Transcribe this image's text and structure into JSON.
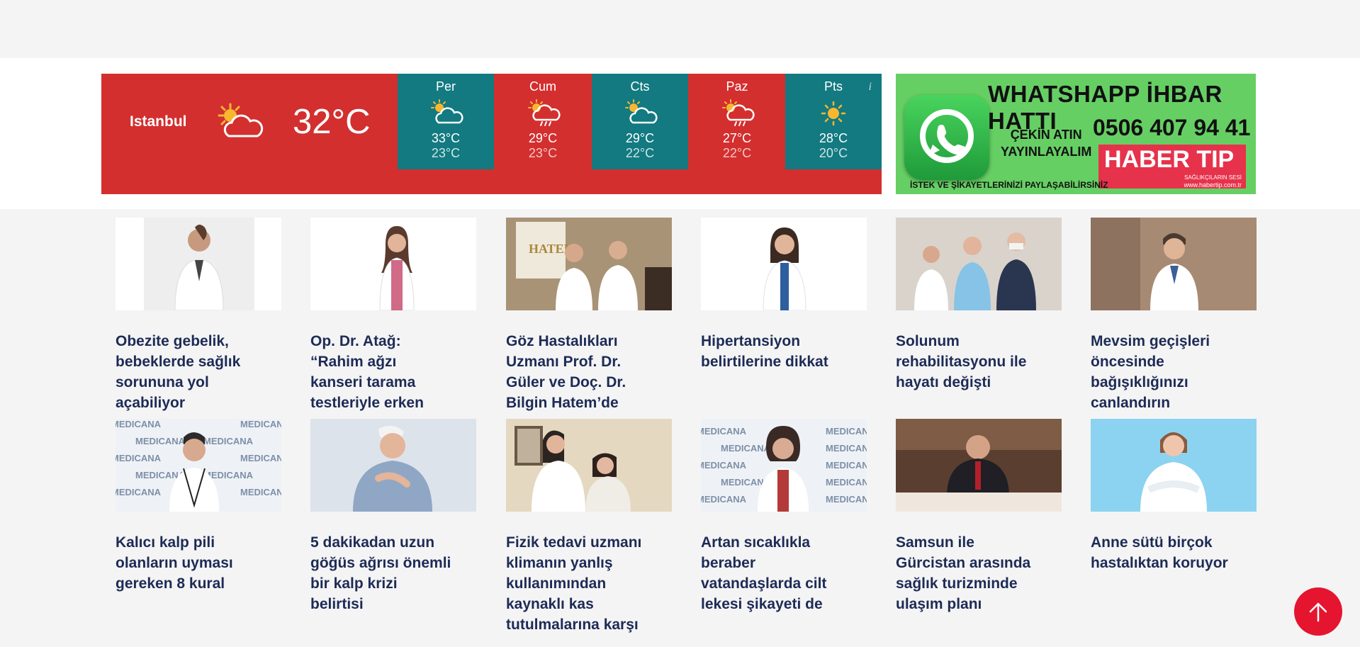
{
  "weather": {
    "city": "Istanbul",
    "current_temp": "32°C",
    "current_icon": "sun-cloud-icon",
    "info": "i",
    "days": [
      {
        "name": "Per",
        "high": "33°C",
        "low": "23°C",
        "icon": "sun-cloud-icon"
      },
      {
        "name": "Cum",
        "high": "29°C",
        "low": "23°C",
        "icon": "sun-cloud-rain-icon"
      },
      {
        "name": "Cts",
        "high": "29°C",
        "low": "22°C",
        "icon": "sun-cloud-icon"
      },
      {
        "name": "Paz",
        "high": "27°C",
        "low": "22°C",
        "icon": "sun-cloud-rain-icon"
      },
      {
        "name": "Pts",
        "high": "28°C",
        "low": "20°C",
        "icon": "sun-icon"
      }
    ]
  },
  "ad": {
    "title": "WHATSHAPP İHBAR HATTI",
    "phone": "0506 407 94 41",
    "cta_line1": "ÇEKİN ATIN",
    "cta_line2": "YAYINLAYALIM",
    "brand": "HABER TIP",
    "brand_sub": "SAĞLIKÇILARIN SESİ",
    "url": "www.habertip.com.tr",
    "footer": "İSTEK VE ŞİKAYETLERİNİZİ PAYLAŞABİLİRSİNİZ"
  },
  "news": [
    {
      "title": "Obezite gebelik, bebeklerde sağlık sorununa yol açabiliyor"
    },
    {
      "title": "Op. Dr. Atağ: “Rahim ağzı kanseri tarama testleriyle erken teşhis edilebilir”"
    },
    {
      "title": "Göz Hastalıkları Uzmanı Prof. Dr. Güler ve Doç. Dr. Bilgin Hatem’de"
    },
    {
      "title": "Hipertansiyon belirtilerine dikkat"
    },
    {
      "title": "Solunum rehabilitasyonu ile hayatı değişti"
    },
    {
      "title": "Mevsim geçişleri öncesinde bağışıklığınızı canlandırın"
    },
    {
      "title": "Kalıcı kalp pili olanların uyması gereken 8 kural"
    },
    {
      "title": "5 dakikadan uzun göğüs ağrısı önemli bir kalp krizi belirtisi"
    },
    {
      "title": "Fizik tedavi uzmanı klimanın yanlış kullanımından kaynaklı kas tutulmalarına karşı uyardı"
    },
    {
      "title": "Artan sıcaklıkla beraber vatandaşlarda cilt lekesi şikayeti de artıyor"
    },
    {
      "title": "Samsun ile Gürcistan arasında sağlık turizminde ulaşım planı"
    },
    {
      "title": "Anne sütü birçok hastalıktan koruyor"
    }
  ],
  "thumb_text": {
    "medicana": "MEDICANA",
    "hatem": "HATEM"
  },
  "colors": {
    "weather_red": "#d32f2f",
    "weather_teal": "#127a80",
    "title_navy": "#1d2b55",
    "scroll_top_red": "#e5152f",
    "ad_green": "#66cf64"
  },
  "scroll_top": {
    "icon": "arrow-up-icon"
  }
}
